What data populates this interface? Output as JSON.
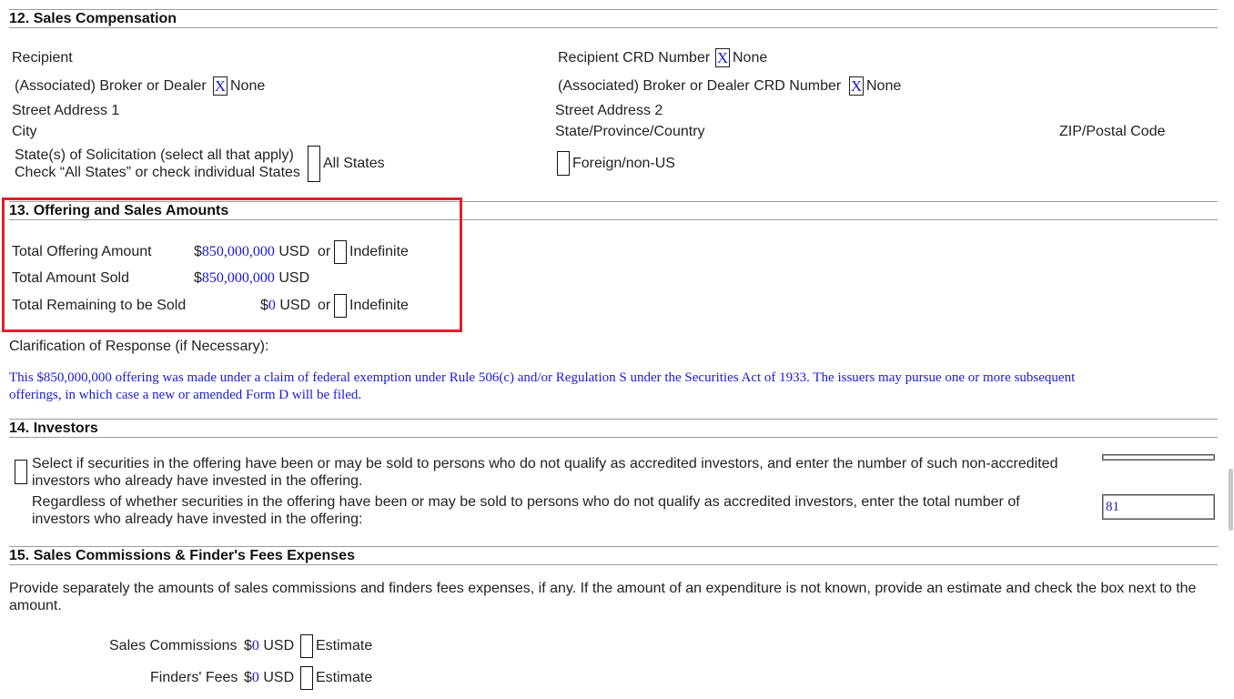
{
  "section12": {
    "title": "12. Sales Compensation",
    "recipient_label": "Recipient",
    "recipient_crd_label": "Recipient CRD Number",
    "x_mark": "X",
    "none_label": "None",
    "assoc_broker_label": "(Associated) Broker or Dealer",
    "assoc_broker_crd_label": "(Associated) Broker or Dealer CRD Number",
    "street1_label": "Street Address 1",
    "street2_label": "Street Address 2",
    "city_label": "City",
    "state_label": "State/Province/Country",
    "zip_label": "ZIP/Postal Code",
    "solicitation_line1": "State(s) of Solicitation (select all that apply)",
    "solicitation_line2": "Check “All States” or check individual States",
    "all_states_label": "All States",
    "foreign_label": "Foreign/non-US"
  },
  "section13": {
    "title": "13. Offering and Sales Amounts",
    "total_offering_label": "Total Offering Amount",
    "total_offering_value": "850,000,000",
    "total_sold_label": "Total Amount Sold",
    "total_sold_value": "850,000,000",
    "total_remaining_label": "Total Remaining to be Sold",
    "total_remaining_value": "0",
    "currency_symbol": "$",
    "currency": "USD",
    "or_label": "or",
    "indefinite_label": "Indefinite",
    "clarification_label": "Clarification of Response (if Necessary):",
    "clarification_line1": "This $850,000,000 offering was made under a claim of federal exemption under Rule 506(c) and/or Regulation S under the Securities Act of 1933. The issuers may pursue one or more subsequent",
    "clarification_line2": "offerings, in which case a new or amended Form D will be filed."
  },
  "section14": {
    "title": "14. Investors",
    "non_accredited_line1": "Select if securities in the offering have been or may be sold to persons who do not qualify as accredited investors, and enter the number of such non-accredited",
    "non_accredited_line2": "investors who already have invested in the offering.",
    "total_investors_line1": "Regardless of whether securities in the offering have been or may be sold to persons who do not qualify as accredited investors, enter the total number of",
    "total_investors_line2": "investors who already have invested in the offering:",
    "total_investors_value": "81"
  },
  "section15": {
    "title": "15. Sales Commissions & Finder's Fees Expenses",
    "intro_line1": "Provide separately the amounts of sales commissions and finders fees expenses, if any. If the amount of an expenditure is not known, provide an estimate and check the box next to the",
    "intro_line2": "amount.",
    "sales_commissions_label": "Sales Commissions",
    "sales_commissions_value": "0",
    "finders_fees_label": "Finders' Fees",
    "finders_fees_value": "0",
    "estimate_label": "Estimate"
  },
  "colors": {
    "value_blue": "#1a1ad6",
    "highlight_red": "#e0202a"
  }
}
